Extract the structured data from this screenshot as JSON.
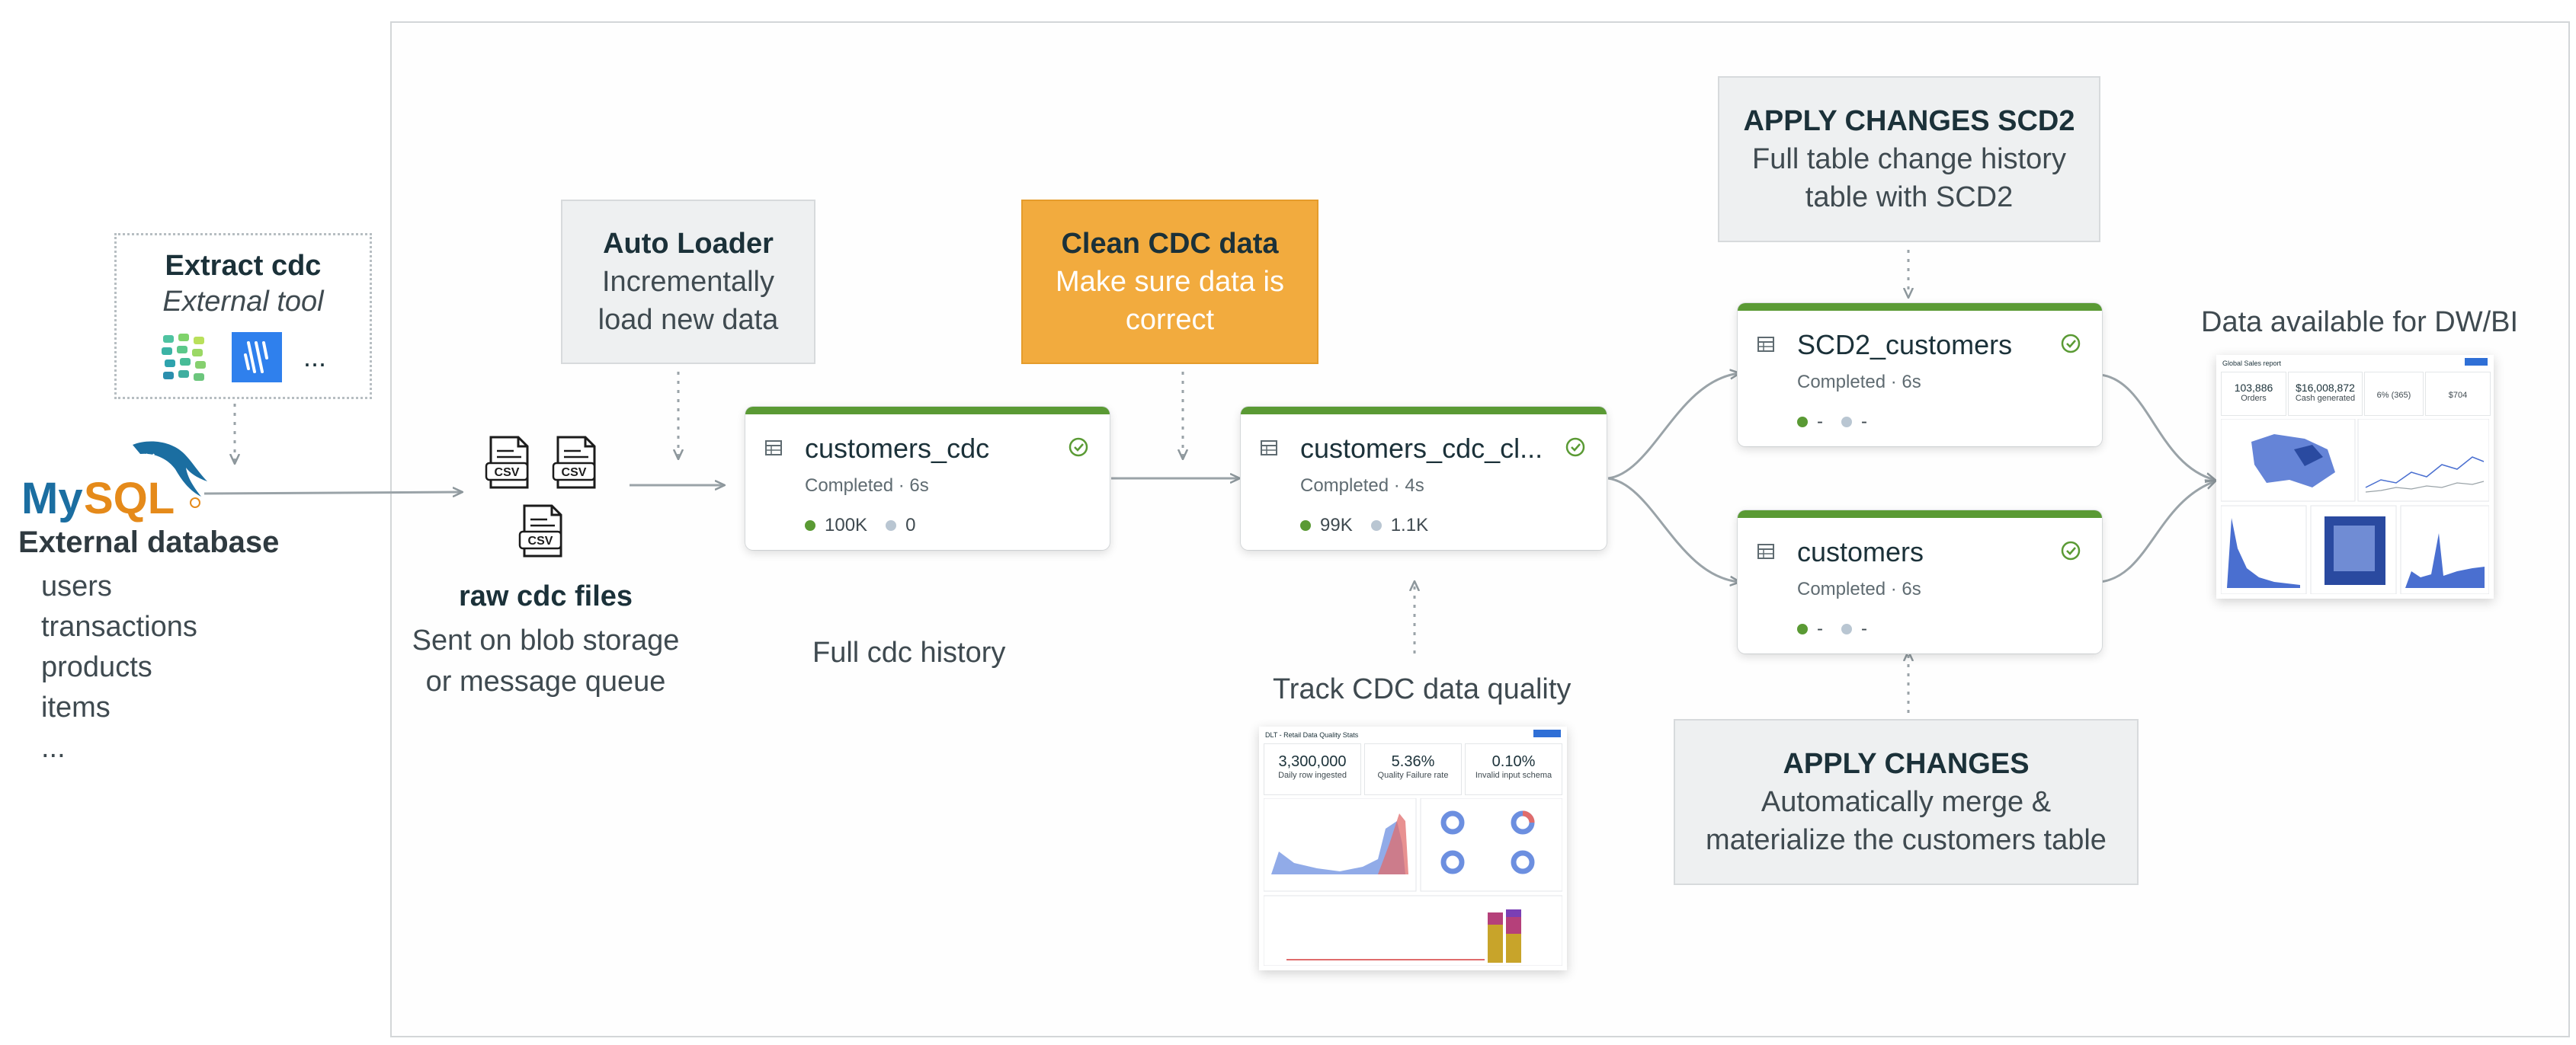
{
  "extract": {
    "title": "Extract cdc",
    "subtitle": "External tool",
    "more": "..."
  },
  "database": {
    "logo_text": "MySQL",
    "title": "External database",
    "tables": [
      "users",
      "transactions",
      "products",
      "items",
      "..."
    ]
  },
  "raw_files": {
    "file_label": "CSV",
    "title": "raw cdc files",
    "subtitle_line1": "Sent on blob storage",
    "subtitle_line2": "or message queue"
  },
  "auto_loader": {
    "title": "Auto Loader",
    "line1": "Incrementally",
    "line2": "load new data"
  },
  "clean_cdc": {
    "title": "Clean CDC data",
    "line1": "Make sure data is",
    "line2": "correct"
  },
  "scd2_box": {
    "title": "APPLY CHANGES SCD2",
    "line1": "Full table change history",
    "line2": "table with SCD2"
  },
  "apply_box": {
    "title": "APPLY CHANGES",
    "line1": "Automatically merge &",
    "line2": "materialize the customers table"
  },
  "nodes": {
    "customers_cdc": {
      "name": "customers_cdc",
      "status": "Completed · 6s",
      "stat1": "100K",
      "stat2": "0"
    },
    "customers_cdc_clean": {
      "name": "customers_cdc_cl...",
      "status": "Completed · 4s",
      "stat1": "99K",
      "stat2": "1.1K"
    },
    "scd2_customers": {
      "name": "SCD2_customers",
      "status": "Completed · 6s",
      "stat1": "-",
      "stat2": "-"
    },
    "customers": {
      "name": "customers",
      "status": "Completed · 6s",
      "stat1": "-",
      "stat2": "-"
    }
  },
  "labels": {
    "full_cdc_history": "Full cdc history",
    "track_quality": "Track CDC data quality",
    "dw_bi": "Data available for DW/BI"
  },
  "quality_dashboard": {
    "title": "DLT - Retail Data Quality Stats",
    "kpi1_value": "3,300,000",
    "kpi1_label": "Daily row ingested",
    "kpi2_value": "5.36%",
    "kpi2_label": "Quality Failure rate",
    "kpi3_value": "0.10%",
    "kpi3_label": "Invalid input schema"
  },
  "sales_dashboard": {
    "title": "Global Sales report",
    "kpi1_value": "103,886",
    "kpi1_label": "Orders",
    "kpi2_value": "$16,008,872",
    "kpi2_label": "Cash generated",
    "kpi3_value": "6% (365)",
    "kpi4_value": "$704"
  },
  "colors": {
    "node_accent": "#5a9a34",
    "clean_box": "#f2ab3e",
    "text_dark": "#1b3139"
  }
}
